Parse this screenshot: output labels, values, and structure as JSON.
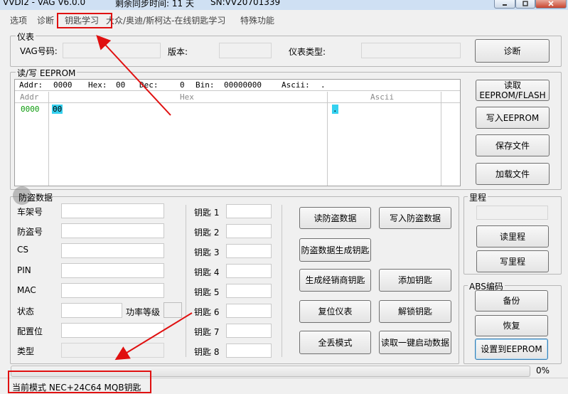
{
  "window": {
    "title": "VVDI2 - VAG V6.0.0",
    "sync_time": "剩余同步时间: 11 天",
    "serial": "SN:VV20701339"
  },
  "menu": [
    "选项",
    "诊断",
    "钥匙学习",
    "大众/奥迪/斯柯达-在线钥匙学习",
    "特殊功能"
  ],
  "instrument": {
    "legend": "仪表",
    "vag_label": "VAG号码:",
    "version_label": "版本:",
    "type_label": "仪表类型:",
    "diag_button": "诊断"
  },
  "eeprom": {
    "legend": "读/写 EEPROM",
    "addr_label": "Addr:",
    "addr_value": "0000",
    "hex_label": "Hex:",
    "hex_value": "00",
    "dec_label": "Dec:",
    "dec_value": "0",
    "bin_label": "Bin:",
    "bin_value": "00000000",
    "ascii_label": "Ascii:",
    "ascii_value": ".",
    "col_addr": "Addr",
    "col_hex": "Hex",
    "col_ascii": "Ascii",
    "row_addr": "0000",
    "row_hex": "00",
    "row_ascii": ".",
    "read_button": "读取\nEEPROM/FLASH",
    "write_button": "写入EEPROM",
    "save_button": "保存文件",
    "load_button": "加载文件"
  },
  "immo": {
    "legend": "防盗数据",
    "fields": [
      "车架号",
      "防盗号",
      "CS",
      "PIN",
      "MAC",
      "状态",
      "配置位",
      "类型"
    ],
    "power_label": "功率等级",
    "keys": [
      "钥匙 1",
      "钥匙 2",
      "钥匙 3",
      "钥匙 4",
      "钥匙 5",
      "钥匙 6",
      "钥匙 7",
      "钥匙 8"
    ],
    "buttons": {
      "read_immo": "读防盗数据",
      "write_immo": "写入防盗数据",
      "gen_key": "防盗数据生成钥匙",
      "gen_dealer": "生成经销商钥匙",
      "add_key": "添加钥匙",
      "reset": "复位仪表",
      "unlock_key": "解锁钥匙",
      "all_lost": "全丢模式",
      "read_start": "读取一键启动数据"
    }
  },
  "mileage": {
    "legend": "里程",
    "read_button": "读里程",
    "write_button": "写里程"
  },
  "abs": {
    "legend": "ABS编码",
    "backup_button": "备份",
    "restore_button": "恢复",
    "set_button": "设置到EEPROM"
  },
  "progress": {
    "value": 0,
    "label": "0%"
  },
  "status": {
    "text": "当前模式 NEC+24C64 MQB钥匙"
  },
  "colors": {
    "annotation": "#e01010",
    "highlight": "#35d1f0",
    "addr_green": "#0a9a0a"
  }
}
